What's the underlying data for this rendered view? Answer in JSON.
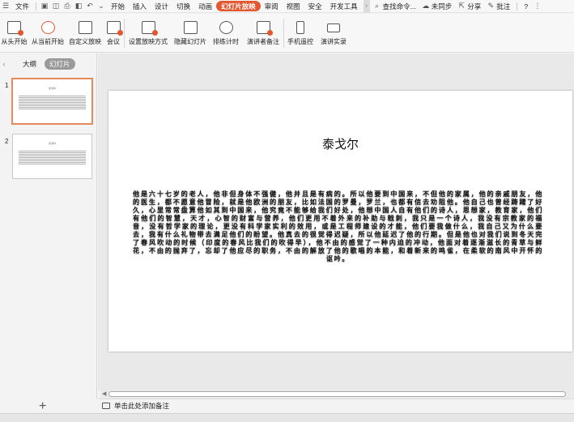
{
  "menubar": {
    "file_menu": "文件",
    "tabs": [
      "开始",
      "插入",
      "设计",
      "切换",
      "动画",
      "幻灯片放映",
      "审阅",
      "视图",
      "安全",
      "开发工具"
    ],
    "active_tab": "幻灯片放映",
    "search": "查找命令...",
    "sync": "未同步",
    "share": "分享",
    "comment": "批注",
    "help": "?"
  },
  "ribbon": {
    "buttons": [
      {
        "label": "从头开始",
        "icon": "play-from-start-icon"
      },
      {
        "label": "从当前开始",
        "icon": "play-current-icon"
      },
      {
        "label": "自定义放映",
        "icon": "custom-show-icon"
      },
      {
        "label": "会议",
        "icon": "meeting-icon"
      },
      {
        "label": "设置放映方式",
        "icon": "setup-show-icon"
      },
      {
        "label": "隐藏幻灯片",
        "icon": "hide-slide-icon"
      },
      {
        "label": "排练计时",
        "icon": "rehearse-timing-icon"
      },
      {
        "label": "演讲者备注",
        "icon": "speaker-notes-icon"
      },
      {
        "label": "手机遥控",
        "icon": "phone-remote-icon"
      },
      {
        "label": "演讲实录",
        "icon": "record-icon"
      }
    ]
  },
  "panel": {
    "tab_outline": "大纲",
    "tab_slides": "幻灯片",
    "slide_numbers": [
      "1",
      "2"
    ],
    "thumb_title": "泰戈尔",
    "add_slide": "+"
  },
  "slide": {
    "title": "泰戈尔",
    "body": "他是六十七岁的老人，他非但身体不强健，他并且是有病的。所以他要到中国来，不但他的家属，他的亲戚朋友，他的医生，都不愿意他冒险，就是他欧洲的朋友，比如法国的罗曼，罗兰，也都有信去劝阻他。他自己也曾经踌躇了好久，心里常常盘算他如其到中国来，他究竟不能够给我们好处，他想中国人自有他们的诗人，思想家，教育家，他们有他们的智慧，天才，心智的财富与营养，他们更用不着外来的补助与戟刺，我只是一个诗人，我没有宗教家的福音，没有哲学家的理论，更没有科学家实利的效用，或是工程师建设的才能，他们要我做什么，我自己又为什么要去，我有什么礼物带去满足他们的盼望。他真去的很觉得迟疑，所以他延迟了他的行期。但是他也对我们说到冬天完了春风吹动的时候（印度的春风比我们的吹得早），他不由的感觉了一种内迫的冲动，他面对着逐渐滋长的青草与鲜花，不由的抛弃了，忘却了他应尽的职务，不由的解放了他的歌唱的本能，和着新来的鸣雀，在柔软的南风中开怀的讴吟。"
  },
  "notes": {
    "placeholder": "单击此处添加备注"
  }
}
